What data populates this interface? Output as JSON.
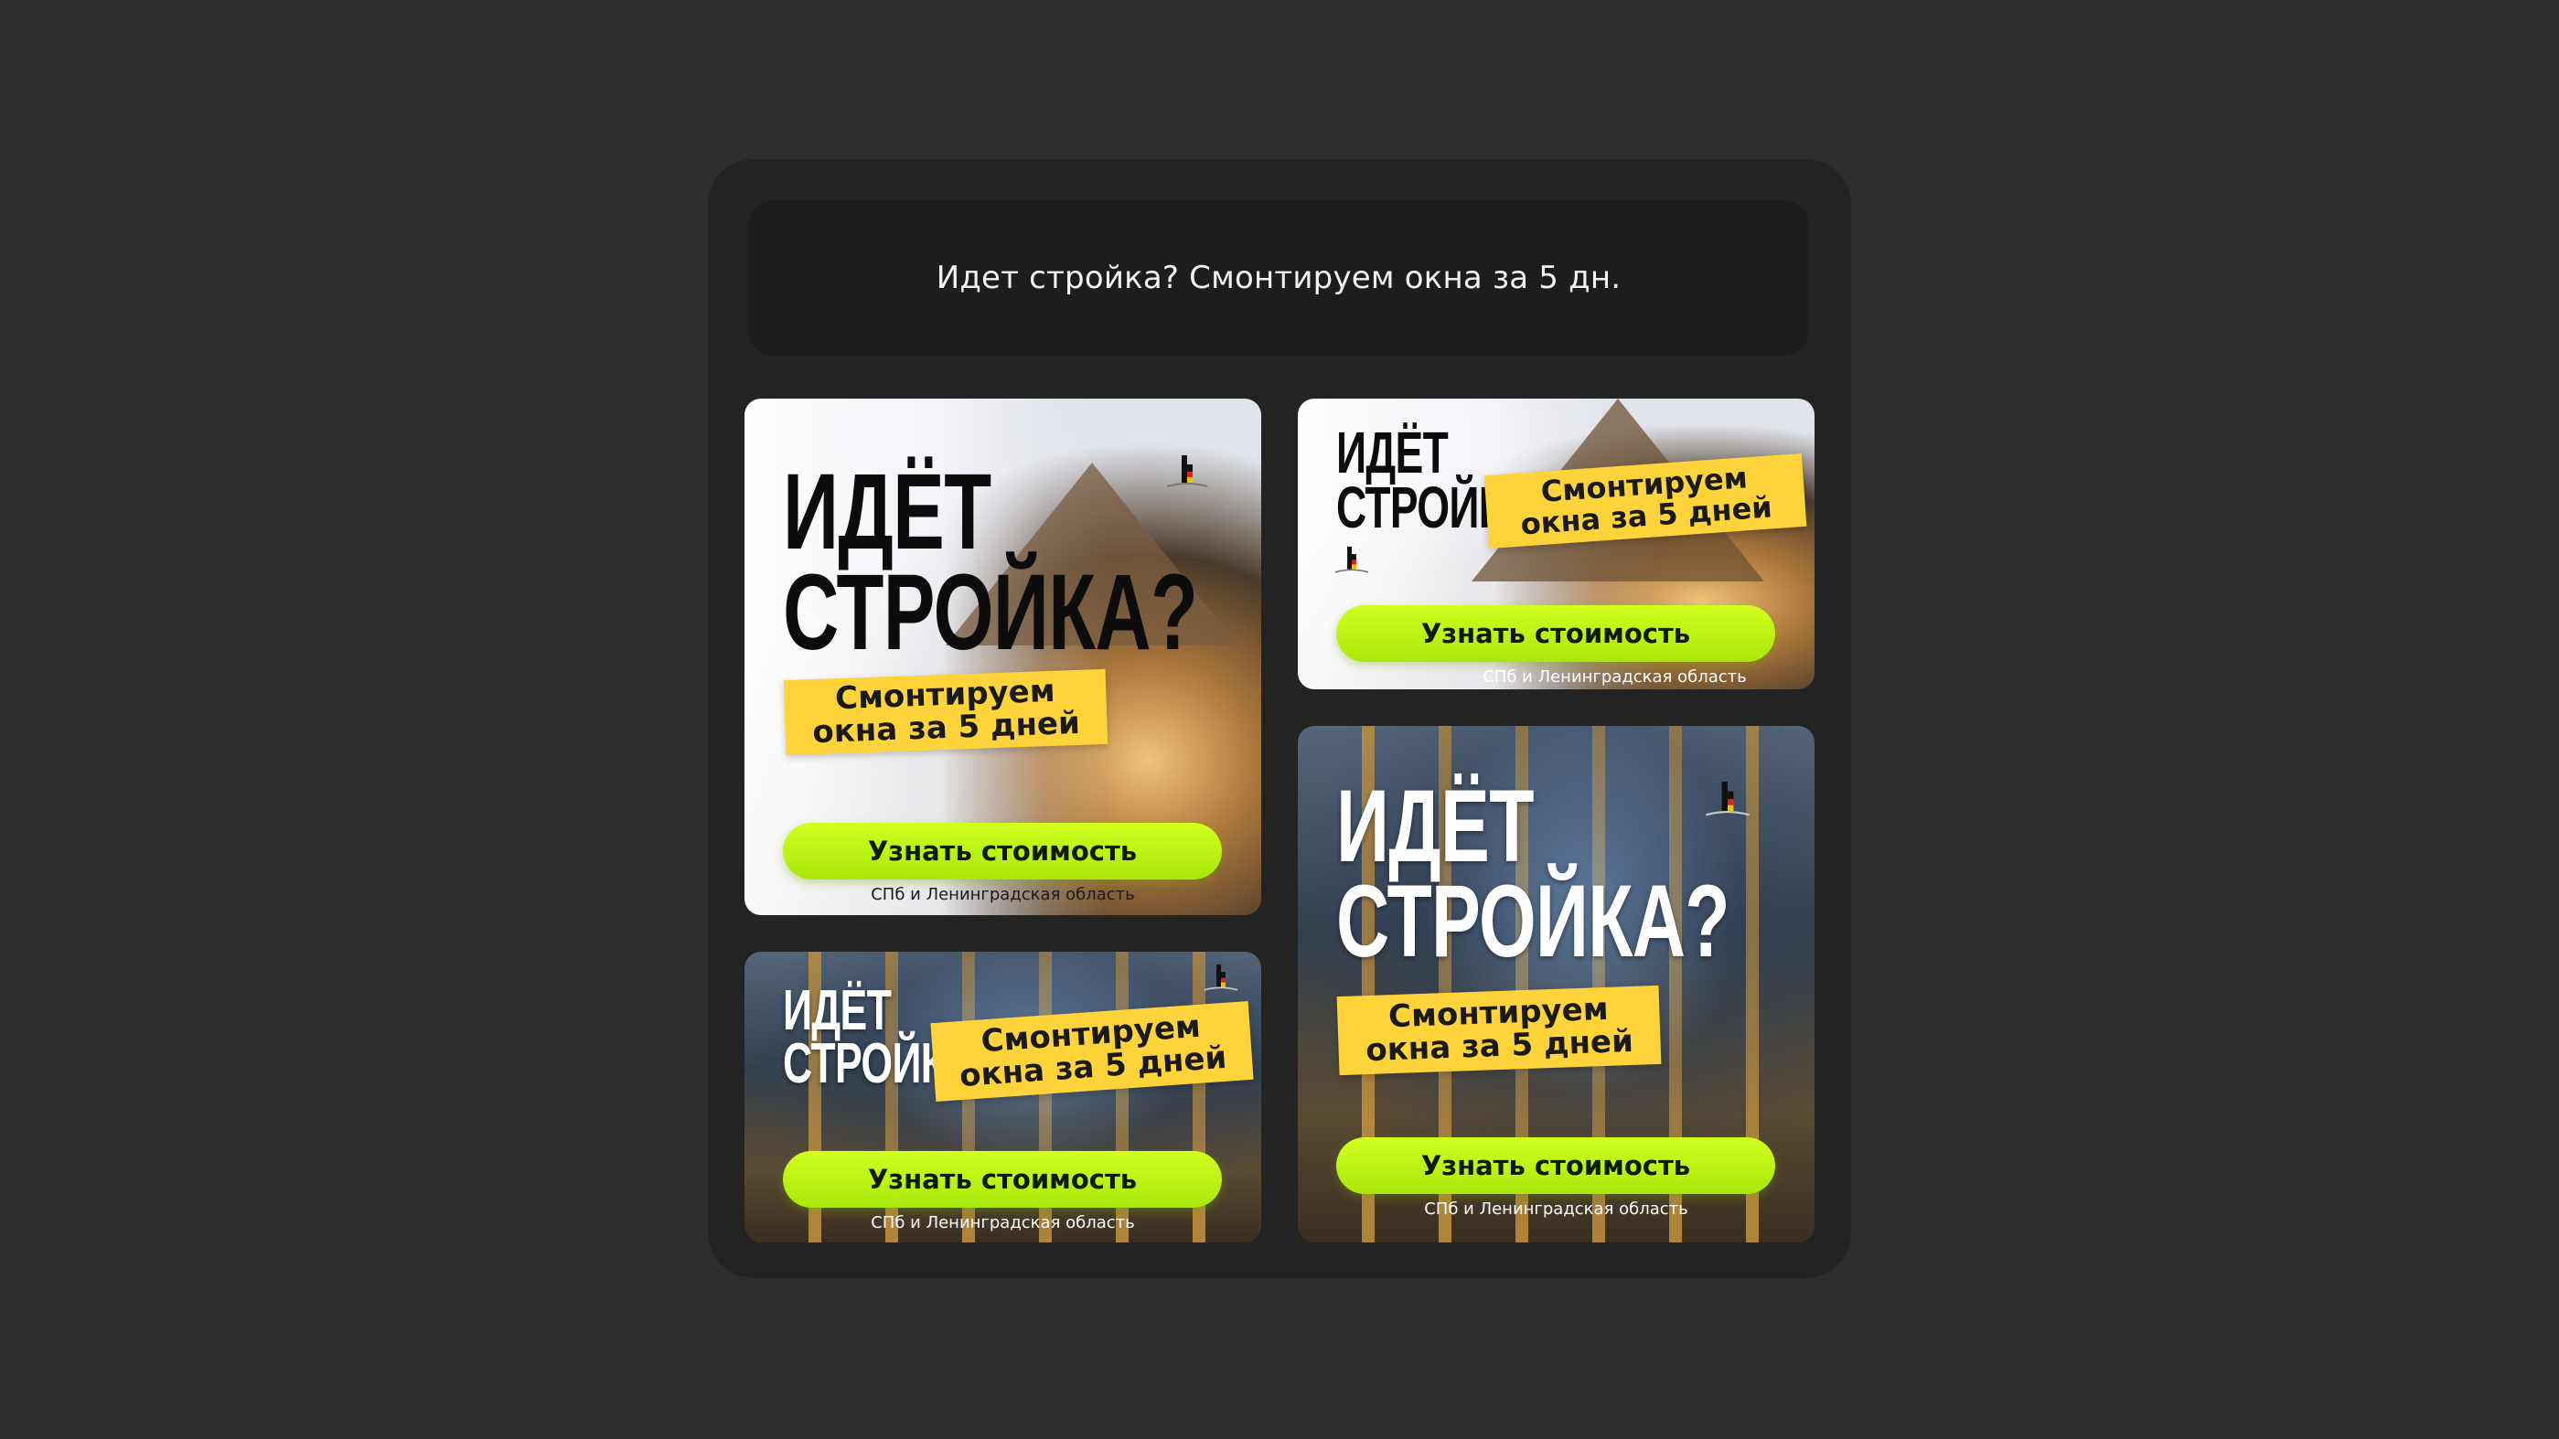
{
  "caption": "Идет стройка? Смонтируем окна за 5 дн.",
  "cards": {
    "a": {
      "headline_1": "ИДЁТ",
      "headline_2": "СТРОЙКА?",
      "tag_1": "Смонтируем",
      "tag_2": "окна за 5 дней",
      "cta": "Узнать стоимость",
      "region": "СПб и Ленинградская область"
    },
    "b": {
      "headline_1": "ИДЁТ",
      "headline_2": "СТРОЙКА?",
      "tag_1": "Смонтируем",
      "tag_2": "окна за 5 дней",
      "cta": "Узнать стоимость",
      "region": "СПб и Ленинградская область"
    },
    "c": {
      "headline_1": "ИДЁТ",
      "headline_2": "СТРОЙКА?",
      "tag_1": "Смонтируем",
      "tag_2": "окна за 5 дней",
      "cta": "Узнать стоимость",
      "region": "СПб и Ленинградская область"
    },
    "d": {
      "headline_1": "ИДЁТ",
      "headline_2": "СТРОЙКА?",
      "tag_1": "Смонтируем",
      "tag_2": "окна за 5 дней",
      "cta": "Узнать стоимость",
      "region": "СПб и Ленинградская область"
    }
  },
  "colors": {
    "background": "#2d2d2d",
    "panel": "#232323",
    "tag": "#ffd43b",
    "cta": "#c4f516"
  },
  "icons": {
    "logo": "house-flag-logo-icon"
  }
}
